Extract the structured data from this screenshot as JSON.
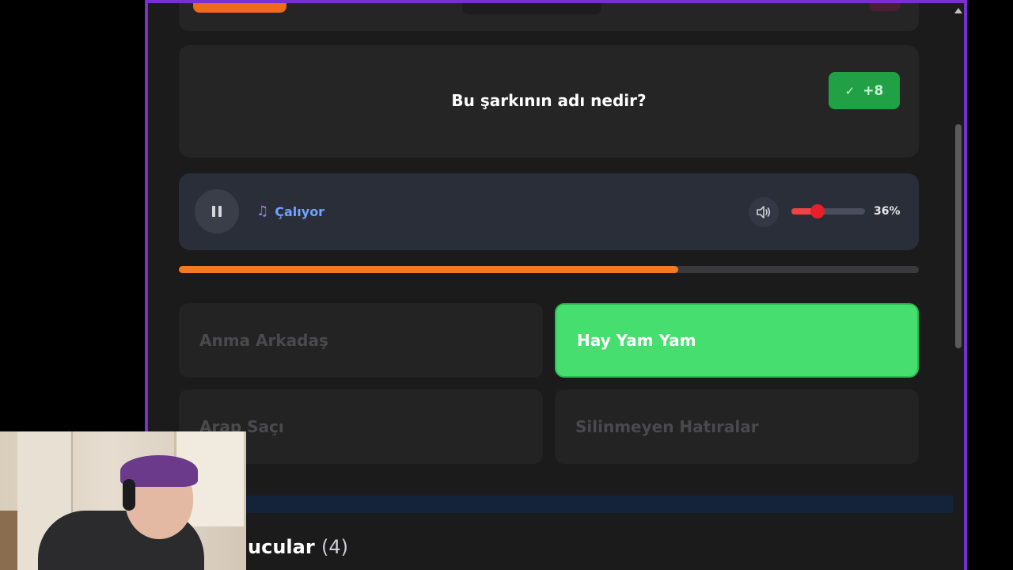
{
  "question": {
    "text": "Bu şarkının adı nedir?",
    "score_badge": "+8",
    "score_color": "#22a046"
  },
  "player": {
    "status_label": "Çalıyor",
    "volume_label": "36%",
    "volume_level": 0.36,
    "icons": [
      "pause-icon",
      "music-note-icon",
      "speaker-icon"
    ]
  },
  "progress": {
    "fraction": 0.675,
    "color": "#f27a22"
  },
  "answers": [
    {
      "label": "Anma Arkadaş",
      "state": "disabled"
    },
    {
      "label": "Hay Yam Yam",
      "state": "correct"
    },
    {
      "label": "Arap Saçı",
      "state": "disabled"
    },
    {
      "label": "Silinmeyen Hatıralar",
      "state": "disabled"
    }
  ],
  "players_section": {
    "title_partial": "ucular",
    "count": "(4)"
  },
  "accent": "#7b2fd0"
}
